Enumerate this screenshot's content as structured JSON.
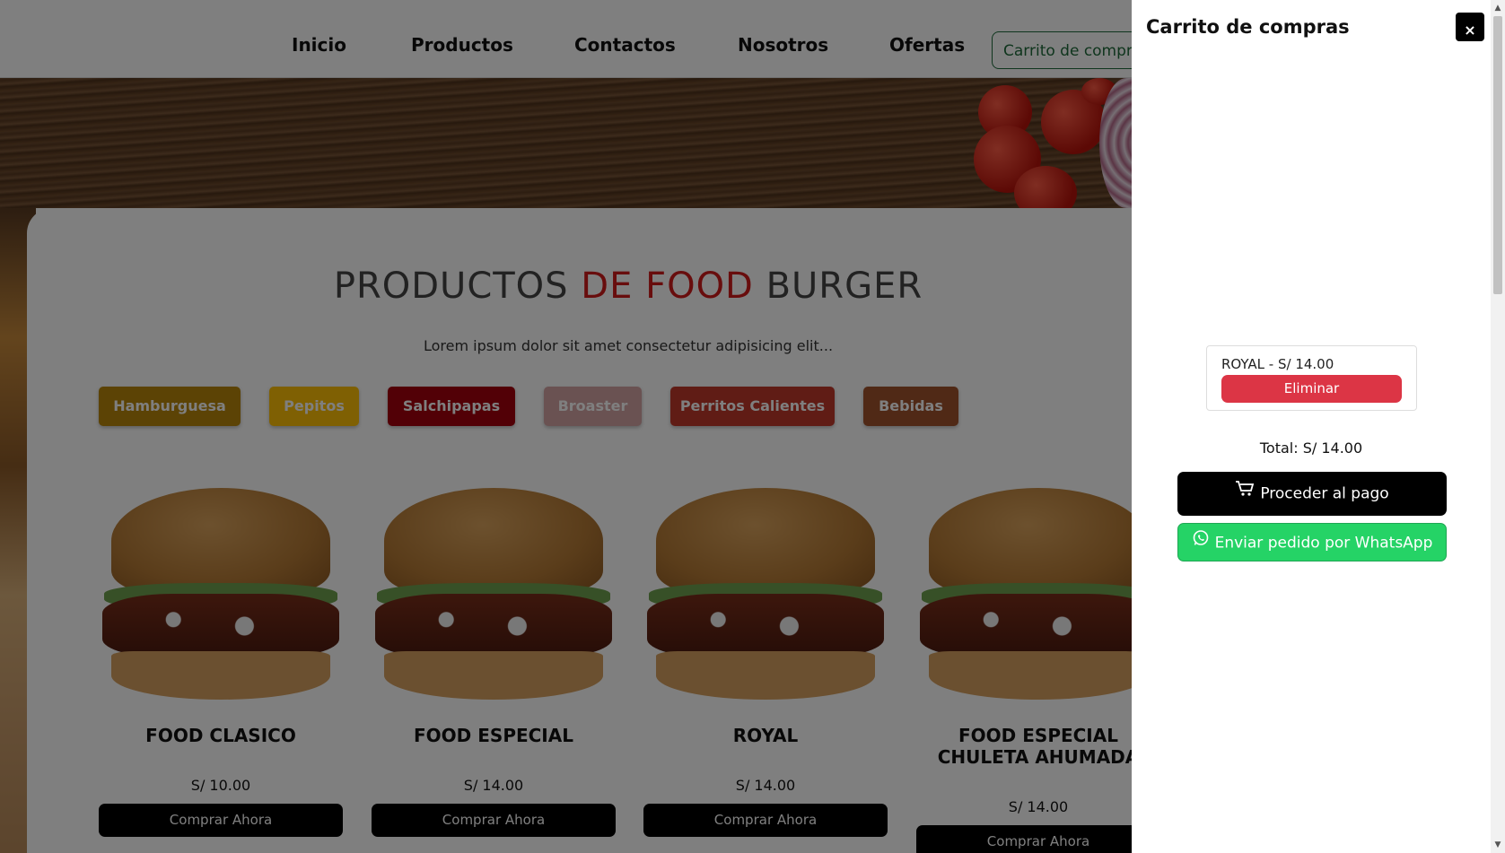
{
  "nav": {
    "items": [
      "Inicio",
      "Productos",
      "Contactos",
      "Nosotros",
      "Ofertas"
    ],
    "cart_button": "Carrito de compras"
  },
  "section": {
    "title_part1": "PRODUCTOS ",
    "title_part2": "DE FOOD",
    "title_part3": " BURGER",
    "subtitle": "Lorem ipsum dolor sit amet consectetur adipisicing elit..."
  },
  "categories": [
    {
      "label": "Hamburguesa",
      "color": "#b8860b"
    },
    {
      "label": "Pepitos",
      "color": "#ffc107"
    },
    {
      "label": "Salchipapas",
      "color": "#a4000d"
    },
    {
      "label": "Broaster",
      "color": "#d4a5a5"
    },
    {
      "label": "Perritos Calientes",
      "color": "#c0392b"
    },
    {
      "label": "Bebidas",
      "color": "#a0522d"
    }
  ],
  "products": [
    {
      "name": "FOOD CLASICO",
      "price": "S/ 10.00",
      "button": "Comprar Ahora"
    },
    {
      "name": "FOOD ESPECIAL",
      "price": "S/ 14.00",
      "button": "Comprar Ahora"
    },
    {
      "name": "ROYAL",
      "price": "S/ 14.00",
      "button": "Comprar Ahora"
    },
    {
      "name": "FOOD ESPECIAL CHULETA AHUMADA",
      "price": "S/ 14.00",
      "button": "Comprar Ahora"
    }
  ],
  "cart": {
    "title": "Carrito de compras",
    "close": "×",
    "items": [
      {
        "label": "ROYAL - S/ 14.00",
        "remove": "Eliminar"
      }
    ],
    "total": "Total: S/ 14.00",
    "pay_button": "Proceder al pago",
    "whatsapp_button": "Enviar pedido por WhatsApp"
  },
  "colors": {
    "accent_red": "#d11a1a",
    "remove_red": "#dc3545",
    "whatsapp_green": "#25d366",
    "cart_border_green": "#1f6b3a"
  },
  "icons": [
    "cart-icon",
    "whatsapp-icon",
    "close-icon"
  ]
}
